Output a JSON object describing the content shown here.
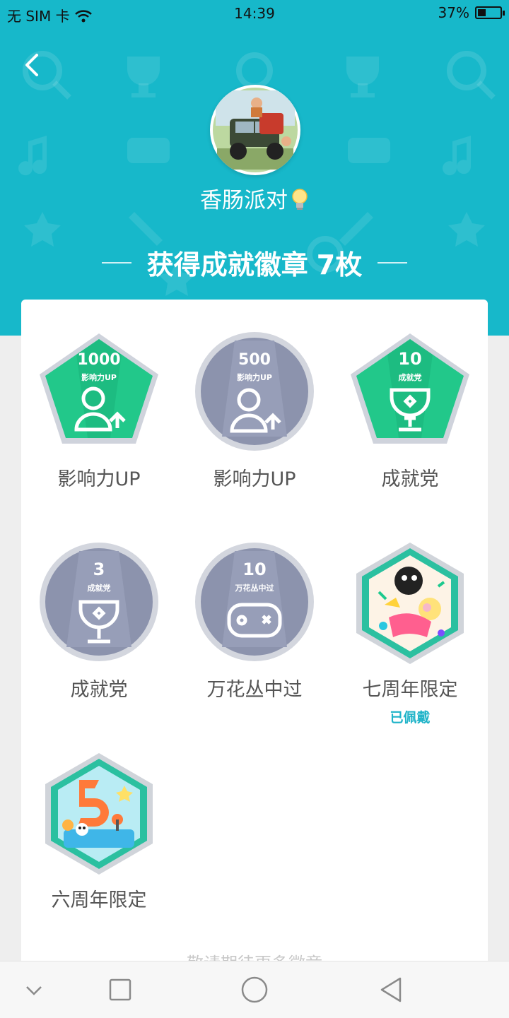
{
  "status_bar": {
    "carrier": "无 SIM 卡",
    "time": "14:39",
    "battery": "37%",
    "battery_level": 0.37
  },
  "profile": {
    "nickname": "香肠派对"
  },
  "summary": {
    "prefix": "获得成就徽章",
    "count": "7枚"
  },
  "badges": [
    {
      "name": "影响力UP",
      "top": "1000",
      "sub": "影响力UP",
      "shape": "pentagon",
      "color": "green",
      "icon": "user-up-icon"
    },
    {
      "name": "影响力UP",
      "top": "500",
      "sub": "影响力UP",
      "shape": "circle",
      "color": "gray",
      "icon": "user-up-icon"
    },
    {
      "name": "成就党",
      "top": "10",
      "sub": "成就党",
      "shape": "pentagon",
      "color": "green",
      "icon": "trophy-icon"
    },
    {
      "name": "成就党",
      "top": "3",
      "sub": "成就党",
      "shape": "circle",
      "color": "gray",
      "icon": "trophy-icon"
    },
    {
      "name": "万花丛中过",
      "top": "10",
      "sub": "万花丛中过",
      "shape": "circle",
      "color": "gray",
      "icon": "gamepad-icon"
    },
    {
      "name": "七周年限定",
      "status": "已佩戴",
      "shape": "hexagon",
      "color": "art7",
      "icon": "seventh-anniversary-art"
    },
    {
      "name": "六周年限定",
      "shape": "hexagon",
      "color": "art6",
      "icon": "sixth-anniversary-art"
    }
  ],
  "footer_hint": "敬请期待更多徽章",
  "colors": {
    "header": "#17b8ca",
    "badge_green": "#22c88a",
    "badge_gray": "#8c93ad",
    "worn": "#1eb3c8"
  }
}
